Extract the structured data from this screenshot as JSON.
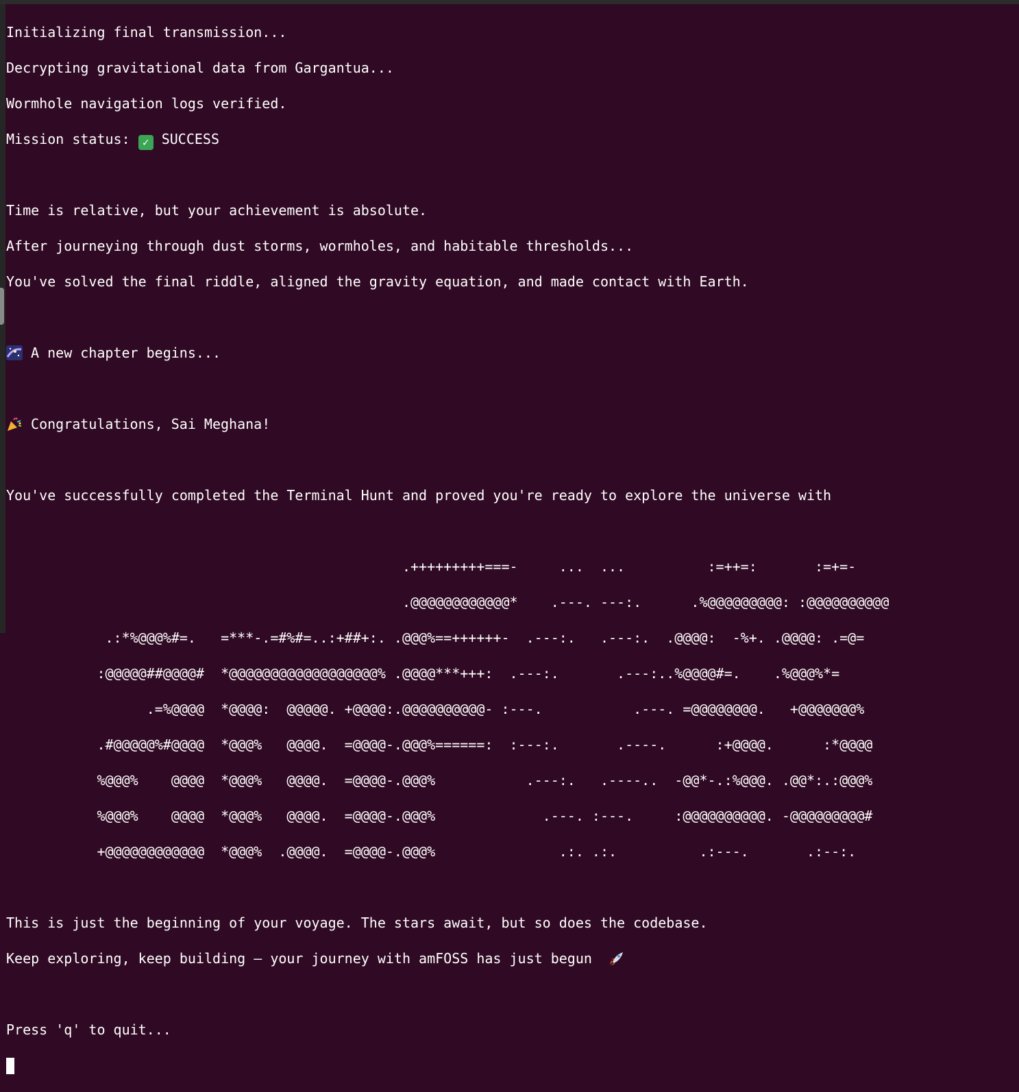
{
  "terminal": {
    "intro": [
      "Initializing final transmission...",
      "Decrypting gravitational data from Gargantua...",
      "Wormhole navigation logs verified."
    ],
    "status_label": "Mission status: ",
    "status_value": " SUCCESS",
    "message": [
      "Time is relative, but your achievement is absolute.",
      "After journeying through dust storms, wormholes, and habitable thresholds...",
      "You've solved the final riddle, aligned the gravity equation, and made contact with Earth."
    ],
    "chapter": " A new chapter begins...",
    "congrats": " Congratulations, Sai Meghana!",
    "completed": "You've successfully completed the Terminal Hunt and proved you're ready to explore the universe with",
    "ascii_art": [
      "                                                .+++++++++===-     ...  ...          :=++=:       :=+=-",
      "                                                .@@@@@@@@@@@@*    .---. ---:.      .%@@@@@@@@@: :@@@@@@@@@@",
      "            .:*%@@@%#=.   =***-.=#%#=..:+##+:. .@@@%==++++++-  .---:.   .---:.  .@@@@:  -%+. .@@@@: .=@=",
      "           :@@@@@##@@@@#  *@@@@@@@@@@@@@@@@@@% .@@@@***+++:  .---:.       .---:..%@@@@#=.    .%@@@%*=",
      "                 .=%@@@@  *@@@@:  @@@@@. +@@@@:.@@@@@@@@@@- :---.           .---. =@@@@@@@@.   +@@@@@@@%",
      "           .#@@@@@%#@@@@  *@@@%   @@@@.  =@@@@-.@@@%======:  :---:.       .----.      :+@@@@.      :*@@@@",
      "           %@@@%    @@@@  *@@@%   @@@@.  =@@@@-.@@@%           .---:.   .----..  -@@*-.:%@@@. .@@*:.:@@@%",
      "           %@@@%    @@@@  *@@@%   @@@@.  =@@@@-.@@@%             .---. :---.     :@@@@@@@@@@. -@@@@@@@@@#",
      "           +@@@@@@@@@@@@  *@@@%  .@@@@.  =@@@@-.@@@%               .:. .:.          .:---.       .:--:."
    ],
    "closing": [
      "This is just the beginning of your voyage. The stars await, but so does the codebase.",
      "Keep exploring, keep building — your journey with amFOSS has just begun  "
    ],
    "quit_prompt": "Press 'q' to quit...",
    "status_glyph": "✓"
  },
  "icons": [
    "check-icon",
    "galaxy-icon",
    "party-popper-icon",
    "rocket-icon"
  ],
  "colors": {
    "background": "#300a24",
    "foreground": "#ffffff",
    "success_badge": "#3aa655"
  }
}
